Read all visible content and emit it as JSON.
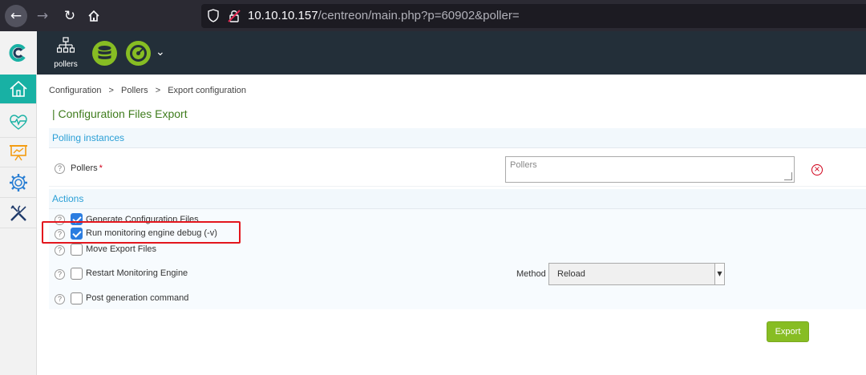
{
  "browser": {
    "url_host": "10.10.10.157",
    "url_path": "/centreon/main.php?p=60902&poller="
  },
  "topbar": {
    "pollers_label": "pollers"
  },
  "breadcrumb": {
    "items": [
      "Configuration",
      "Pollers",
      "Export configuration"
    ],
    "separator": ">"
  },
  "page": {
    "title": "| Configuration Files Export"
  },
  "sections": {
    "polling": "Polling instances",
    "actions": "Actions"
  },
  "form": {
    "pollers_label": "Pollers",
    "pollers_required": "*",
    "pollers_placeholder": "Pollers",
    "generate_label": "Generate Configuration Files",
    "generate_checked": true,
    "debug_label": "Run monitoring engine debug (-v)",
    "debug_checked": true,
    "move_label": "Move Export Files",
    "move_checked": false,
    "restart_label": "Restart Monitoring Engine",
    "restart_checked": false,
    "method_label": "Method",
    "method_value": "Reload",
    "post_label": "Post generation command",
    "post_checked": false,
    "help_glyph": "?"
  },
  "actions": {
    "export_label": "Export"
  },
  "colors": {
    "brand_teal": "#18b1a4",
    "brand_green": "#87bd23",
    "header_dark": "#232f39",
    "link_blue": "#2a9fd6",
    "highlight_red": "#e3161d"
  }
}
